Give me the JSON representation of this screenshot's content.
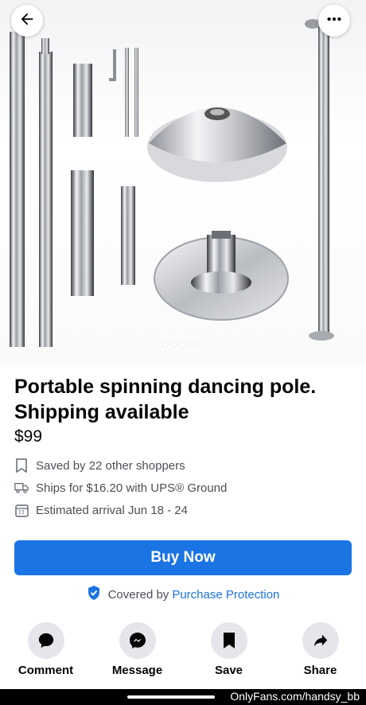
{
  "colors": {
    "accent": "#1b74e4",
    "secondary_text": "#4b4f56",
    "action_bg": "#e4e6eb"
  },
  "hero": {
    "back_icon": "arrow-left-icon",
    "more_icon": "ellipsis-icon",
    "photo_count": 5,
    "active_photo": 1
  },
  "listing": {
    "title": "Portable spinning dancing pole. Shipping available",
    "price": "$99",
    "saved": "Saved by 22 other shoppers",
    "shipping": "Ships for $16.20 with UPS® Ground",
    "arrival": "Estimated arrival Jun 18 - 24"
  },
  "buy_label": "Buy Now",
  "protection": {
    "prefix": "Covered by",
    "link": "Purchase Protection"
  },
  "actions": [
    {
      "label": "Comment",
      "icon": "comment-icon"
    },
    {
      "label": "Message",
      "icon": "messenger-icon"
    },
    {
      "label": "Save",
      "icon": "bookmark-icon"
    },
    {
      "label": "Share",
      "icon": "share-icon"
    }
  ],
  "watermark": "OnlyFans.com/handsy_bb"
}
